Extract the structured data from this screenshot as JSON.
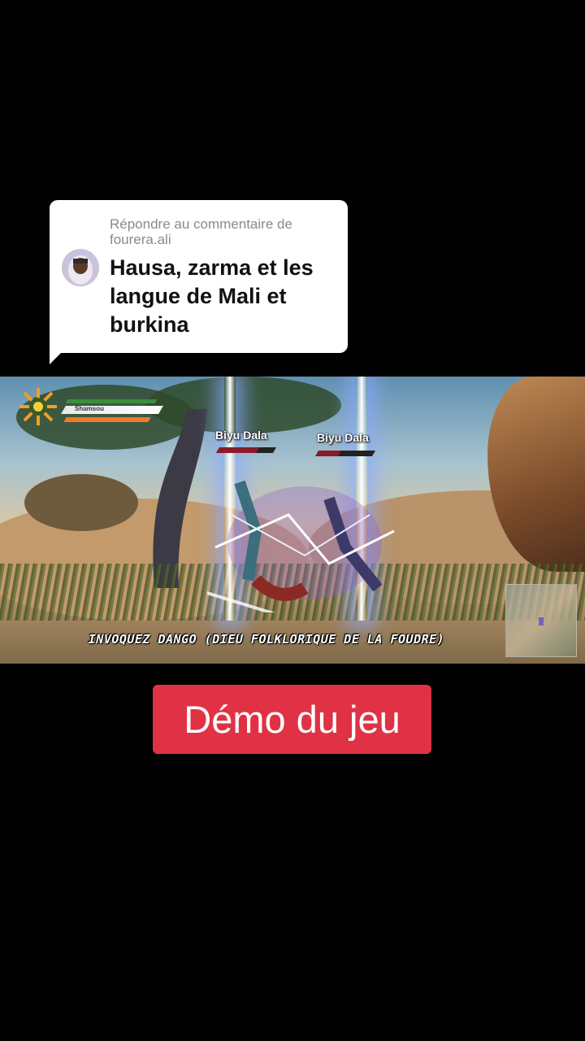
{
  "reply": {
    "label": "Répondre au commentaire de fourera.ali",
    "comment": "Hausa, zarma et les langue de Mali et burkina"
  },
  "game": {
    "player_name": "Shamsou",
    "enemies": [
      {
        "name": "Biyu Dala",
        "health_pct": 70
      },
      {
        "name": "Biyu Dala",
        "health_pct": 40
      }
    ],
    "subtitle": "INVOQUEZ DANGO (DIEU FOLKLORIQUE DE LA FOUDRE)"
  },
  "cta": {
    "label": "Démo du jeu",
    "color": "#e03244"
  },
  "icons": [
    "sun-emblem-icon",
    "minimap-icon",
    "avatar-image"
  ]
}
